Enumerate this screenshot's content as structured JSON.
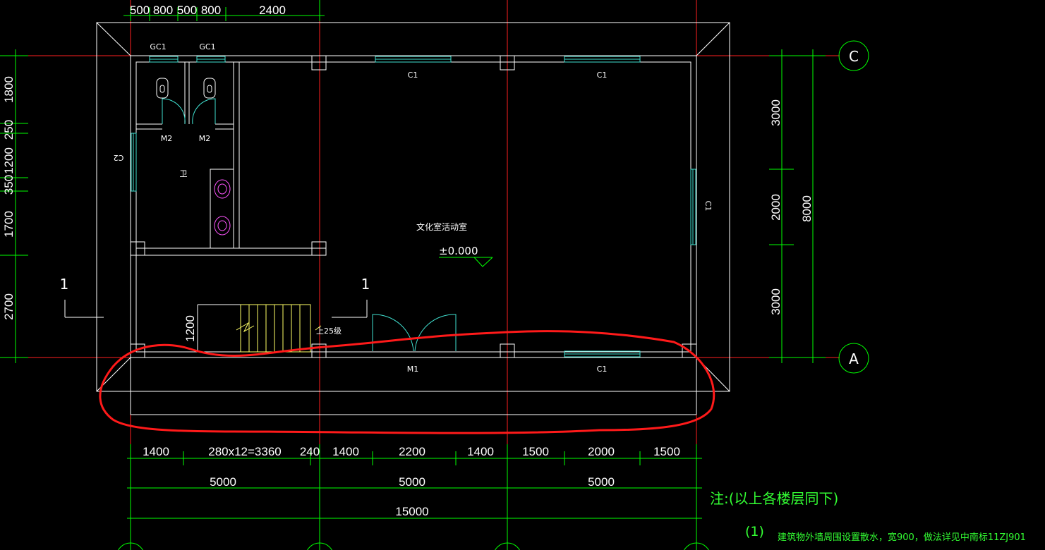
{
  "colors": {
    "background": "#000000",
    "wall": "#ffffff",
    "axis": "#ff2020",
    "dimension": "#00ff00",
    "window": "#40e0d0",
    "stair": "#ffff66",
    "fixture": "#ff55ff",
    "markup": "#ff1a1a",
    "note": "#33ff33"
  },
  "axes": {
    "c": "C",
    "a": "A"
  },
  "dims_top": [
    "500",
    "800",
    "500",
    "800",
    "2400"
  ],
  "dims_left": [
    "1800",
    "250",
    "1200",
    "350",
    "1700",
    "2700"
  ],
  "dims_right": [
    "3000",
    "2000",
    "3000",
    "8000"
  ],
  "dims_bottom_row1": [
    "1400",
    "280x12=3360",
    "240",
    "1400",
    "2200",
    "1400",
    "1500",
    "2000",
    "1500"
  ],
  "dims_bottom_row2": [
    "5000",
    "5000",
    "5000"
  ],
  "dims_bottom_total": "15000",
  "labels": {
    "gc1_a": "GC1",
    "gc1_b": "GC1",
    "c1_top_a": "C1",
    "c1_top_b": "C1",
    "c1_bottom": "C1",
    "c1_right": "C1",
    "c2_left": "C2",
    "m2_a": "M2",
    "m2_b": "M2",
    "m1": "M1",
    "room": "文化室活动室",
    "elevation": "±0.000",
    "stair_note": "上25级",
    "stair_width": "1200",
    "section_left": "1",
    "section_right": "1",
    "toilet_mark": "卫"
  },
  "note": {
    "title": "注:(以上各楼层同下)",
    "item_no": "(1)",
    "item_text": "建筑物外墙周围设置散水，宽900，做法详见中南标11ZJ901"
  }
}
